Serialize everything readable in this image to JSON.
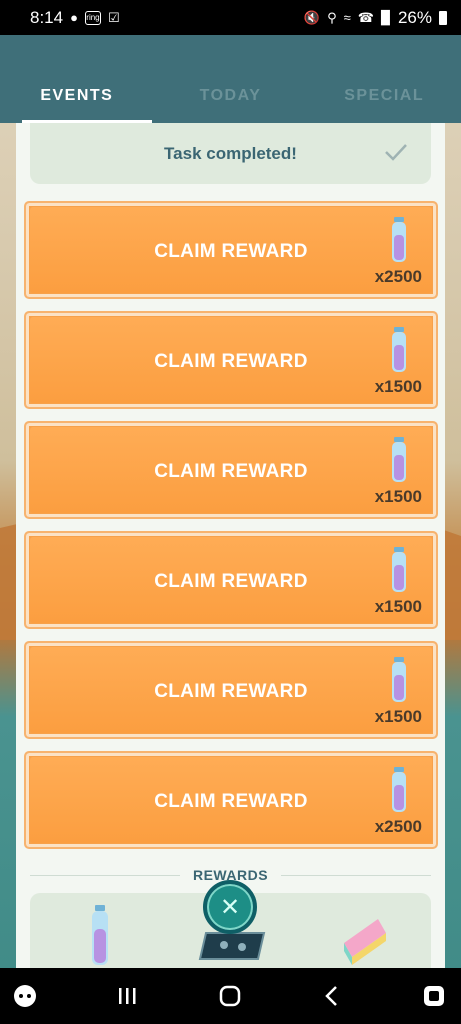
{
  "status_bar": {
    "time": "8:14",
    "ring_label": "ring",
    "battery": "26%"
  },
  "tabs": [
    {
      "label": "EVENTS",
      "active": true
    },
    {
      "label": "TODAY",
      "active": false
    },
    {
      "label": "SPECIAL",
      "active": false
    }
  ],
  "task": {
    "text": "Task completed!"
  },
  "rewards": [
    {
      "label": "CLAIM REWARD",
      "count": "x2500",
      "item_icon": "stardust-vial-icon"
    },
    {
      "label": "CLAIM REWARD",
      "count": "x1500",
      "item_icon": "stardust-vial-icon"
    },
    {
      "label": "CLAIM REWARD",
      "count": "x1500",
      "item_icon": "stardust-vial-icon"
    },
    {
      "label": "CLAIM REWARD",
      "count": "x1500",
      "item_icon": "stardust-vial-icon"
    },
    {
      "label": "CLAIM REWARD",
      "count": "x1500",
      "item_icon": "stardust-vial-icon"
    },
    {
      "label": "CLAIM REWARD",
      "count": "x2500",
      "item_icon": "stardust-vial-icon"
    }
  ],
  "rewards_section": {
    "title": "REWARDS"
  },
  "colors": {
    "header": "#3f6f79",
    "claim_button": "#fb9e40",
    "panel": "#f3f7f2",
    "close_button": "#1d8e86"
  }
}
